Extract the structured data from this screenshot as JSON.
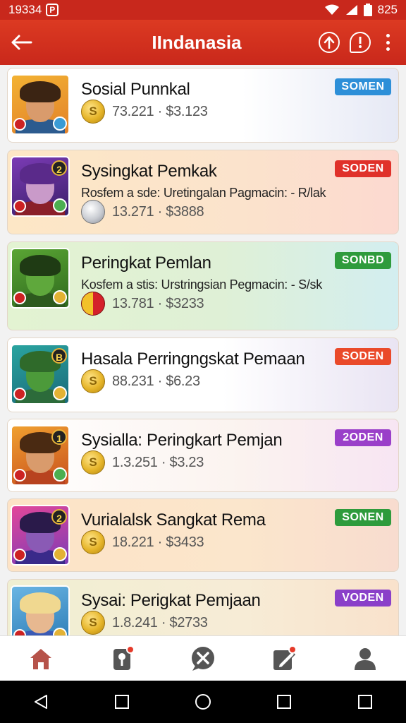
{
  "status_bar": {
    "time": "19334",
    "app_icon_letter": "P",
    "battery": "825"
  },
  "app_bar": {
    "title": "IIndanasia"
  },
  "cards": [
    {
      "name": "Sosial Punnkal",
      "desc": "",
      "stats": "73.221 · $3.123",
      "badge": "SOMEN",
      "badge_color": "#2d8fd8",
      "bg": "linear-gradient(90deg,#ffffff 0%,#ffffff 60%,#e6e9f5 100%)",
      "rank": "",
      "coin": "gold",
      "palette": {
        "hair": "#3b2413",
        "face": "#d99b6c",
        "body": "#2c5b8f",
        "bgA": "#f3b233",
        "bgB": "#e2812a",
        "dot": "#3a9bd5"
      }
    },
    {
      "name": "Sysingkat Pemkak",
      "desc": "Rosfem a sde: Uretingalan Pagmacin: - R/lak",
      "stats": "13.271 · $3888",
      "badge": "SODEN",
      "badge_color": "#e0312a",
      "bg": "linear-gradient(90deg,#fde7c6 0%,#fbe3cc 60%,#fcd9d0 100%)",
      "rank": "2",
      "coin": "silver",
      "palette": {
        "hair": "#5a2a8a",
        "face": "#c99ac9",
        "body": "#8a1f2a",
        "bgA": "#7b3bb5",
        "bgB": "#3a1f6a",
        "dot": "#4caf50"
      }
    },
    {
      "name": "Peringkat Pemlan",
      "desc": "Kosfem a stis: Urstringsian Pegmacin: - S/sk",
      "stats": "13.781 · $3233",
      "badge": "SONBD",
      "badge_color": "#2e9b3c",
      "bg": "linear-gradient(90deg,#e3f3d2 0%,#dff0d6 55%,#d3eef0 100%)",
      "rank": "",
      "coin": "red",
      "palette": {
        "hair": "#1f3b14",
        "face": "#5fa83c",
        "body": "#2d5a1e",
        "bgA": "#5aa534",
        "bgB": "#2f6a1e",
        "dot": "#e3b234"
      }
    },
    {
      "name": "Hasala Perringngskat Pemaan",
      "desc": "",
      "stats": "88.231 · $6.23",
      "badge": "SODEN",
      "badge_color": "#ea4a2a",
      "bg": "linear-gradient(90deg,#ffffff 0%,#ffffff 55%,#e9e4f3 100%)",
      "rank": "B",
      "coin": "gold",
      "palette": {
        "hair": "#2f6a2a",
        "face": "#4c9a3a",
        "body": "#2c6b3a",
        "bgA": "#2aa4a0",
        "bgB": "#1a6a7a",
        "dot": "#e3b234"
      }
    },
    {
      "name": "Sysialla: Peringkart Pemjan",
      "desc": "",
      "stats": "1.3.251 · $3.23",
      "badge": "2ODEN",
      "badge_color": "#9a3fc9",
      "bg": "linear-gradient(90deg,#ffffff 0%,#fbf3ef 60%,#f7e5f3 100%)",
      "rank": "1",
      "coin": "gold",
      "palette": {
        "hair": "#4a2a12",
        "face": "#d99b6c",
        "body": "#b8431f",
        "bgA": "#f0a030",
        "bgB": "#c8501e",
        "dot": "#4caf50"
      }
    },
    {
      "name": "Vurialalsk Sangkat Rema",
      "desc": "",
      "stats": "18.221 · $3433",
      "badge": "SONEN",
      "badge_color": "#2e9b3c",
      "bg": "linear-gradient(90deg,#fde3c6 0%,#fbe6cc 60%,#f8dccf 100%)",
      "rank": "2",
      "coin": "gold",
      "palette": {
        "hair": "#2a1a4a",
        "face": "#8a5ab5",
        "body": "#3a2a8a",
        "bgA": "#e3479a",
        "bgB": "#7b3bb5",
        "dot": "#e3b234"
      }
    },
    {
      "name": "Sysai: Perigkat Pemjaan",
      "desc": "",
      "stats": "1.8.241 · $2733",
      "badge": "VODEN",
      "badge_color": "#8a3fc9",
      "bg": "linear-gradient(90deg,#f0efd2 0%,#f7ecd6 60%,#f9e2cc 100%)",
      "rank": "",
      "coin": "gold",
      "palette": {
        "hair": "#f0d890",
        "face": "#e7b890",
        "body": "#3a5ab5",
        "bgA": "#6ab5e3",
        "bgB": "#2a7ab5",
        "dot": "#e3b234"
      }
    }
  ],
  "bottom_nav": [
    "home-icon",
    "map-pin-icon",
    "chat-tools-icon",
    "edit-icon",
    "profile-icon"
  ]
}
